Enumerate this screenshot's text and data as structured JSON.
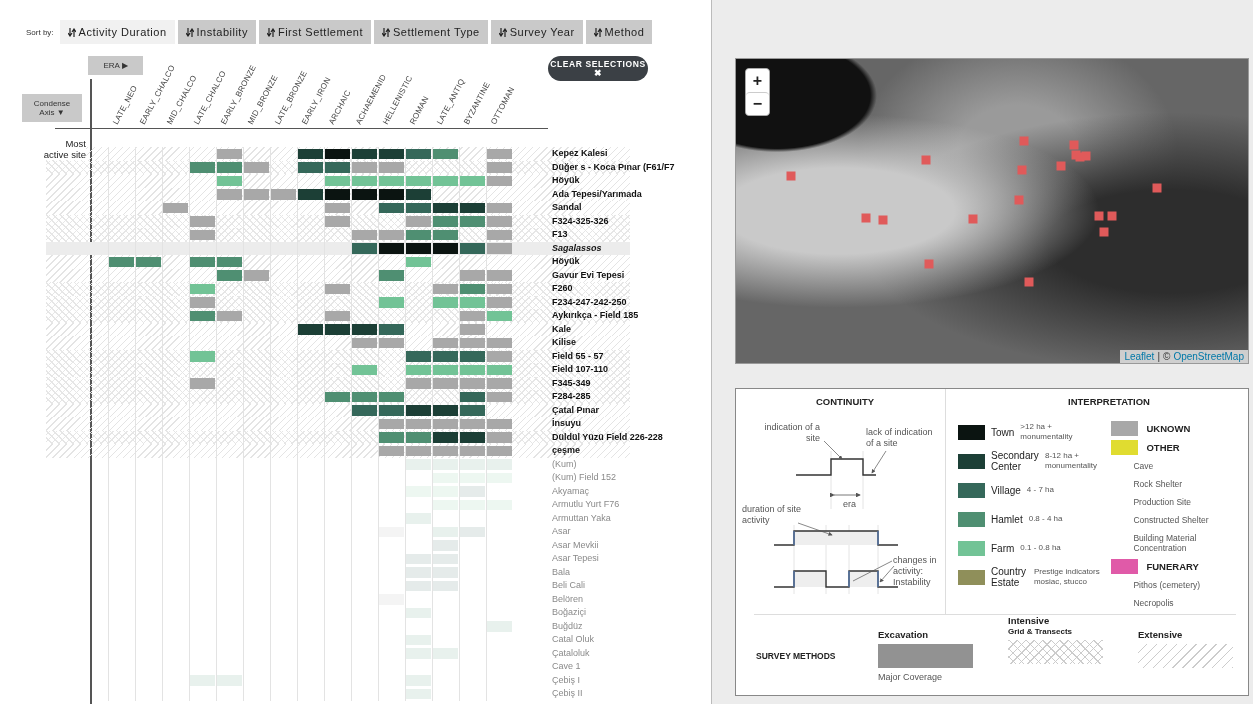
{
  "sort_bar": {
    "label": "Sort by:",
    "options": [
      {
        "label": "Activity Duration",
        "selected": true
      },
      {
        "label": "Instability",
        "selected": false
      },
      {
        "label": "First Settlement",
        "selected": false
      },
      {
        "label": "Settlement Type",
        "selected": false
      },
      {
        "label": "Survey Year",
        "selected": false
      },
      {
        "label": "Method",
        "selected": false
      }
    ]
  },
  "era_button": {
    "label": "ERA",
    "glyph": "▶"
  },
  "condense_button": {
    "label": "Condense Axis",
    "glyph": "▼"
  },
  "clear_button": {
    "label": "CLEAR SELECTIONS",
    "glyph": "✖"
  },
  "most_active_label": "Most active site",
  "eras": [
    "LATE_NEO",
    "EARLY_CHALCO",
    "MID_CHALCO",
    "LATE_CHALCO",
    "EARLY_BRONZE",
    "MID_BRONZE",
    "LATE_BRONZE",
    "EARLY_IRON",
    "ARCHAIC",
    "ACHAEMENID",
    "HELLENISTIC",
    "ROMAN",
    "LATE_ANTIQ",
    "BYZANTINE",
    "OTTOMAN"
  ],
  "sites": [
    {
      "name": "Kepez Kalesi",
      "kind": "extensive",
      "active": true,
      "cells": [
        {
          "kind": "none"
        },
        {
          "kind": "none"
        },
        {
          "kind": "none"
        },
        {
          "kind": "none"
        },
        {
          "kind": "unknown"
        },
        {
          "kind": "none"
        },
        {
          "kind": "none"
        },
        {
          "kind": "secondary"
        },
        {
          "kind": "town"
        },
        {
          "kind": "secondary"
        },
        {
          "kind": "secondary"
        },
        {
          "kind": "village"
        },
        {
          "kind": "hamlet"
        },
        {
          "kind": "none"
        },
        {
          "kind": "unknown"
        }
      ]
    },
    {
      "name": "Düğer s - Koca Pınar (F61/F7",
      "kind": "intensive",
      "active": true,
      "cells": [
        {
          "kind": "none"
        },
        {
          "kind": "none"
        },
        {
          "kind": "none"
        },
        {
          "kind": "hamlet"
        },
        {
          "kind": "hamlet"
        },
        {
          "kind": "unknown"
        },
        {
          "kind": "none"
        },
        {
          "kind": "village"
        },
        {
          "kind": "village"
        },
        {
          "kind": "unknown"
        },
        {
          "kind": "unknown"
        },
        {
          "kind": "none"
        },
        {
          "kind": "none"
        },
        {
          "kind": "none"
        },
        {
          "kind": "unknown"
        }
      ]
    },
    {
      "name": "Höyük",
      "kind": "extensive",
      "active": true,
      "cells": [
        {
          "kind": "none"
        },
        {
          "kind": "none"
        },
        {
          "kind": "none"
        },
        {
          "kind": "none"
        },
        {
          "kind": "farm"
        },
        {
          "kind": "none"
        },
        {
          "kind": "none"
        },
        {
          "kind": "none"
        },
        {
          "kind": "farm"
        },
        {
          "kind": "farm"
        },
        {
          "kind": "farm"
        },
        {
          "kind": "farm"
        },
        {
          "kind": "farm"
        },
        {
          "kind": "farm"
        },
        {
          "kind": "unknown"
        }
      ]
    },
    {
      "name": "Ada Tepesi/Yarımada",
      "kind": "extensive",
      "active": true,
      "cells": [
        {
          "kind": "none"
        },
        {
          "kind": "none"
        },
        {
          "kind": "none"
        },
        {
          "kind": "none"
        },
        {
          "kind": "unknown"
        },
        {
          "kind": "unknown"
        },
        {
          "kind": "unknown"
        },
        {
          "kind": "secondary"
        },
        {
          "kind": "town"
        },
        {
          "kind": "town"
        },
        {
          "kind": "town"
        },
        {
          "kind": "secondary"
        },
        {
          "kind": "none"
        },
        {
          "kind": "none"
        },
        {
          "kind": "none"
        }
      ]
    },
    {
      "name": "Sandal",
      "kind": "extensive",
      "active": true,
      "cells": [
        {
          "kind": "none"
        },
        {
          "kind": "none"
        },
        {
          "kind": "unknown"
        },
        {
          "kind": "none"
        },
        {
          "kind": "none"
        },
        {
          "kind": "none"
        },
        {
          "kind": "none"
        },
        {
          "kind": "none"
        },
        {
          "kind": "unknown"
        },
        {
          "kind": "none"
        },
        {
          "kind": "village"
        },
        {
          "kind": "village"
        },
        {
          "kind": "secondary"
        },
        {
          "kind": "secondary"
        },
        {
          "kind": "unknown"
        }
      ]
    },
    {
      "name": "F324-325-326",
      "kind": "intensive",
      "active": true,
      "cells": [
        {
          "kind": "none"
        },
        {
          "kind": "none"
        },
        {
          "kind": "none"
        },
        {
          "kind": "unknown"
        },
        {
          "kind": "none"
        },
        {
          "kind": "none"
        },
        {
          "kind": "none"
        },
        {
          "kind": "none"
        },
        {
          "kind": "unknown"
        },
        {
          "kind": "none"
        },
        {
          "kind": "none"
        },
        {
          "kind": "unknown"
        },
        {
          "kind": "hamlet"
        },
        {
          "kind": "hamlet"
        },
        {
          "kind": "unknown"
        }
      ]
    },
    {
      "name": "F13",
      "kind": "intensive",
      "active": true,
      "cells": [
        {
          "kind": "none"
        },
        {
          "kind": "none"
        },
        {
          "kind": "none"
        },
        {
          "kind": "unknown"
        },
        {
          "kind": "none"
        },
        {
          "kind": "none"
        },
        {
          "kind": "none"
        },
        {
          "kind": "none"
        },
        {
          "kind": "none"
        },
        {
          "kind": "unknown"
        },
        {
          "kind": "unknown"
        },
        {
          "kind": "hamlet"
        },
        {
          "kind": "hamlet"
        },
        {
          "kind": "none"
        },
        {
          "kind": "unknown"
        }
      ]
    },
    {
      "name": "Sagalassos",
      "kind": "excavation",
      "active": true,
      "cells": [
        {
          "kind": "none"
        },
        {
          "kind": "none"
        },
        {
          "kind": "none"
        },
        {
          "kind": "none"
        },
        {
          "kind": "none"
        },
        {
          "kind": "none"
        },
        {
          "kind": "none"
        },
        {
          "kind": "none"
        },
        {
          "kind": "none"
        },
        {
          "kind": "village"
        },
        {
          "kind": "town"
        },
        {
          "kind": "town"
        },
        {
          "kind": "town"
        },
        {
          "kind": "village"
        },
        {
          "kind": "unknown"
        }
      ]
    },
    {
      "name": "Höyük",
      "kind": "extensive",
      "active": true,
      "cells": [
        {
          "kind": "hamlet"
        },
        {
          "kind": "hamlet"
        },
        {
          "kind": "none"
        },
        {
          "kind": "hamlet"
        },
        {
          "kind": "hamlet"
        },
        {
          "kind": "none"
        },
        {
          "kind": "none"
        },
        {
          "kind": "none"
        },
        {
          "kind": "none"
        },
        {
          "kind": "none"
        },
        {
          "kind": "none"
        },
        {
          "kind": "farm"
        },
        {
          "kind": "none"
        },
        {
          "kind": "none"
        },
        {
          "kind": "none"
        }
      ]
    },
    {
      "name": "Gavur Evi Tepesi",
      "kind": "extensive",
      "active": true,
      "cells": [
        {
          "kind": "none"
        },
        {
          "kind": "none"
        },
        {
          "kind": "none"
        },
        {
          "kind": "none"
        },
        {
          "kind": "hamlet"
        },
        {
          "kind": "unknown"
        },
        {
          "kind": "none"
        },
        {
          "kind": "none"
        },
        {
          "kind": "none"
        },
        {
          "kind": "none"
        },
        {
          "kind": "hamlet"
        },
        {
          "kind": "none"
        },
        {
          "kind": "none"
        },
        {
          "kind": "unknown"
        },
        {
          "kind": "unknown"
        }
      ]
    },
    {
      "name": "F260",
      "kind": "intensive",
      "active": true,
      "cells": [
        {
          "kind": "none"
        },
        {
          "kind": "none"
        },
        {
          "kind": "none"
        },
        {
          "kind": "farm"
        },
        {
          "kind": "none"
        },
        {
          "kind": "none"
        },
        {
          "kind": "none"
        },
        {
          "kind": "none"
        },
        {
          "kind": "unknown"
        },
        {
          "kind": "none"
        },
        {
          "kind": "none"
        },
        {
          "kind": "none"
        },
        {
          "kind": "unknown"
        },
        {
          "kind": "hamlet"
        },
        {
          "kind": "unknown"
        }
      ]
    },
    {
      "name": "F234-247-242-250",
      "kind": "intensive",
      "active": true,
      "cells": [
        {
          "kind": "none"
        },
        {
          "kind": "none"
        },
        {
          "kind": "none"
        },
        {
          "kind": "unknown"
        },
        {
          "kind": "none"
        },
        {
          "kind": "none"
        },
        {
          "kind": "none"
        },
        {
          "kind": "none"
        },
        {
          "kind": "none"
        },
        {
          "kind": "none"
        },
        {
          "kind": "farm"
        },
        {
          "kind": "none"
        },
        {
          "kind": "farm"
        },
        {
          "kind": "farm"
        },
        {
          "kind": "unknown"
        }
      ]
    },
    {
      "name": "Aykırıkça - Field 185",
      "kind": "intensive",
      "active": true,
      "cells": [
        {
          "kind": "none"
        },
        {
          "kind": "none"
        },
        {
          "kind": "none"
        },
        {
          "kind": "hamlet"
        },
        {
          "kind": "unknown"
        },
        {
          "kind": "none"
        },
        {
          "kind": "none"
        },
        {
          "kind": "none"
        },
        {
          "kind": "unknown"
        },
        {
          "kind": "none"
        },
        {
          "kind": "none"
        },
        {
          "kind": "none"
        },
        {
          "kind": "none"
        },
        {
          "kind": "unknown"
        },
        {
          "kind": "farm"
        }
      ]
    },
    {
      "name": "Kale",
      "kind": "extensive",
      "active": true,
      "cells": [
        {
          "kind": "none"
        },
        {
          "kind": "none"
        },
        {
          "kind": "none"
        },
        {
          "kind": "none"
        },
        {
          "kind": "none"
        },
        {
          "kind": "none"
        },
        {
          "kind": "none"
        },
        {
          "kind": "secondary"
        },
        {
          "kind": "secondary"
        },
        {
          "kind": "secondary"
        },
        {
          "kind": "village"
        },
        {
          "kind": "none"
        },
        {
          "kind": "none"
        },
        {
          "kind": "unknown"
        },
        {
          "kind": "none"
        }
      ]
    },
    {
      "name": "Kilise",
      "kind": "extensive",
      "active": true,
      "cells": [
        {
          "kind": "none"
        },
        {
          "kind": "none"
        },
        {
          "kind": "none"
        },
        {
          "kind": "none"
        },
        {
          "kind": "none"
        },
        {
          "kind": "none"
        },
        {
          "kind": "none"
        },
        {
          "kind": "none"
        },
        {
          "kind": "none"
        },
        {
          "kind": "unknown"
        },
        {
          "kind": "unknown"
        },
        {
          "kind": "none"
        },
        {
          "kind": "unknown"
        },
        {
          "kind": "unknown"
        },
        {
          "kind": "unknown"
        }
      ]
    },
    {
      "name": "Field 55 - 57",
      "kind": "intensive",
      "active": true,
      "cells": [
        {
          "kind": "none"
        },
        {
          "kind": "none"
        },
        {
          "kind": "none"
        },
        {
          "kind": "farm"
        },
        {
          "kind": "none"
        },
        {
          "kind": "none"
        },
        {
          "kind": "none"
        },
        {
          "kind": "none"
        },
        {
          "kind": "none"
        },
        {
          "kind": "none"
        },
        {
          "kind": "none"
        },
        {
          "kind": "village"
        },
        {
          "kind": "village"
        },
        {
          "kind": "village"
        },
        {
          "kind": "unknown"
        }
      ]
    },
    {
      "name": "Field 107-110",
      "kind": "intensive",
      "active": true,
      "cells": [
        {
          "kind": "none"
        },
        {
          "kind": "none"
        },
        {
          "kind": "none"
        },
        {
          "kind": "none"
        },
        {
          "kind": "none"
        },
        {
          "kind": "none"
        },
        {
          "kind": "none"
        },
        {
          "kind": "none"
        },
        {
          "kind": "none"
        },
        {
          "kind": "farm"
        },
        {
          "kind": "none"
        },
        {
          "kind": "farm"
        },
        {
          "kind": "farm"
        },
        {
          "kind": "farm"
        },
        {
          "kind": "farm"
        }
      ]
    },
    {
      "name": "F345-349",
      "kind": "intensive",
      "active": true,
      "cells": [
        {
          "kind": "none"
        },
        {
          "kind": "none"
        },
        {
          "kind": "none"
        },
        {
          "kind": "unknown"
        },
        {
          "kind": "none"
        },
        {
          "kind": "none"
        },
        {
          "kind": "none"
        },
        {
          "kind": "none"
        },
        {
          "kind": "none"
        },
        {
          "kind": "none"
        },
        {
          "kind": "none"
        },
        {
          "kind": "unknown"
        },
        {
          "kind": "unknown"
        },
        {
          "kind": "unknown"
        },
        {
          "kind": "unknown"
        }
      ]
    },
    {
      "name": "F284-285",
      "kind": "intensive",
      "active": true,
      "cells": [
        {
          "kind": "none"
        },
        {
          "kind": "none"
        },
        {
          "kind": "none"
        },
        {
          "kind": "none"
        },
        {
          "kind": "none"
        },
        {
          "kind": "none"
        },
        {
          "kind": "none"
        },
        {
          "kind": "none"
        },
        {
          "kind": "hamlet"
        },
        {
          "kind": "hamlet"
        },
        {
          "kind": "hamlet"
        },
        {
          "kind": "none"
        },
        {
          "kind": "none"
        },
        {
          "kind": "village"
        },
        {
          "kind": "unknown"
        }
      ]
    },
    {
      "name": "Çatal Pınar",
      "kind": "extensive",
      "active": true,
      "cells": [
        {
          "kind": "none"
        },
        {
          "kind": "none"
        },
        {
          "kind": "none"
        },
        {
          "kind": "none"
        },
        {
          "kind": "none"
        },
        {
          "kind": "none"
        },
        {
          "kind": "none"
        },
        {
          "kind": "none"
        },
        {
          "kind": "none"
        },
        {
          "kind": "village"
        },
        {
          "kind": "village"
        },
        {
          "kind": "secondary"
        },
        {
          "kind": "secondary"
        },
        {
          "kind": "village"
        },
        {
          "kind": "none"
        }
      ]
    },
    {
      "name": "İnsuyu",
      "kind": "extensive",
      "active": true,
      "cells": [
        {
          "kind": "none"
        },
        {
          "kind": "none"
        },
        {
          "kind": "none"
        },
        {
          "kind": "none"
        },
        {
          "kind": "none"
        },
        {
          "kind": "none"
        },
        {
          "kind": "none"
        },
        {
          "kind": "none"
        },
        {
          "kind": "none"
        },
        {
          "kind": "none"
        },
        {
          "kind": "unknown"
        },
        {
          "kind": "unknown"
        },
        {
          "kind": "unknown"
        },
        {
          "kind": "unknown"
        },
        {
          "kind": "unknown"
        }
      ]
    },
    {
      "name": "Düldül Yüzü Field 226-228",
      "kind": "intensive",
      "active": true,
      "cells": [
        {
          "kind": "none"
        },
        {
          "kind": "none"
        },
        {
          "kind": "none"
        },
        {
          "kind": "none"
        },
        {
          "kind": "none"
        },
        {
          "kind": "none"
        },
        {
          "kind": "none"
        },
        {
          "kind": "none"
        },
        {
          "kind": "none"
        },
        {
          "kind": "none"
        },
        {
          "kind": "hamlet"
        },
        {
          "kind": "hamlet"
        },
        {
          "kind": "secondary"
        },
        {
          "kind": "secondary"
        },
        {
          "kind": "unknown"
        }
      ]
    },
    {
      "name": "çeşme",
      "kind": "extensive",
      "active": true,
      "cells": [
        {
          "kind": "none"
        },
        {
          "kind": "none"
        },
        {
          "kind": "none"
        },
        {
          "kind": "none"
        },
        {
          "kind": "none"
        },
        {
          "kind": "none"
        },
        {
          "kind": "none"
        },
        {
          "kind": "none"
        },
        {
          "kind": "none"
        },
        {
          "kind": "none"
        },
        {
          "kind": "unknown"
        },
        {
          "kind": "unknown"
        },
        {
          "kind": "unknown"
        },
        {
          "kind": "unknown"
        },
        {
          "kind": "unknown"
        }
      ]
    },
    {
      "name": "(Kum)",
      "active": false,
      "cells": [
        {
          "kind": "none"
        },
        {
          "kind": "none"
        },
        {
          "kind": "none"
        },
        {
          "kind": "none"
        },
        {
          "kind": "none"
        },
        {
          "kind": "none"
        },
        {
          "kind": "none"
        },
        {
          "kind": "none"
        },
        {
          "kind": "none"
        },
        {
          "kind": "none"
        },
        {
          "kind": "none"
        },
        {
          "kind": "hamlet"
        },
        {
          "kind": "hamlet"
        },
        {
          "kind": "hamlet"
        },
        {
          "kind": "hamlet"
        }
      ]
    },
    {
      "name": "(Kum) Field 152",
      "active": false,
      "cells": [
        {
          "kind": "none"
        },
        {
          "kind": "none"
        },
        {
          "kind": "none"
        },
        {
          "kind": "none"
        },
        {
          "kind": "none"
        },
        {
          "kind": "none"
        },
        {
          "kind": "none"
        },
        {
          "kind": "none"
        },
        {
          "kind": "none"
        },
        {
          "kind": "none"
        },
        {
          "kind": "none"
        },
        {
          "kind": "none"
        },
        {
          "kind": "farm"
        },
        {
          "kind": "farm"
        },
        {
          "kind": "farm"
        }
      ]
    },
    {
      "name": "Akyamaç",
      "active": false,
      "cells": [
        {
          "kind": "none"
        },
        {
          "kind": "none"
        },
        {
          "kind": "none"
        },
        {
          "kind": "none"
        },
        {
          "kind": "none"
        },
        {
          "kind": "none"
        },
        {
          "kind": "none"
        },
        {
          "kind": "none"
        },
        {
          "kind": "none"
        },
        {
          "kind": "none"
        },
        {
          "kind": "none"
        },
        {
          "kind": "farm"
        },
        {
          "kind": "farm"
        },
        {
          "kind": "village"
        },
        {
          "kind": "none"
        }
      ]
    },
    {
      "name": "Armutlu Yurt F76",
      "active": false,
      "cells": [
        {
          "kind": "none"
        },
        {
          "kind": "none"
        },
        {
          "kind": "none"
        },
        {
          "kind": "none"
        },
        {
          "kind": "none"
        },
        {
          "kind": "none"
        },
        {
          "kind": "none"
        },
        {
          "kind": "none"
        },
        {
          "kind": "none"
        },
        {
          "kind": "none"
        },
        {
          "kind": "none"
        },
        {
          "kind": "none"
        },
        {
          "kind": "farm"
        },
        {
          "kind": "farm"
        },
        {
          "kind": "farm"
        }
      ]
    },
    {
      "name": "Armuttan Yaka",
      "active": false,
      "cells": [
        {
          "kind": "none"
        },
        {
          "kind": "none"
        },
        {
          "kind": "none"
        },
        {
          "kind": "none"
        },
        {
          "kind": "none"
        },
        {
          "kind": "none"
        },
        {
          "kind": "none"
        },
        {
          "kind": "none"
        },
        {
          "kind": "none"
        },
        {
          "kind": "none"
        },
        {
          "kind": "none"
        },
        {
          "kind": "hamlet"
        },
        {
          "kind": "none"
        },
        {
          "kind": "none"
        },
        {
          "kind": "none"
        }
      ]
    },
    {
      "name": "Asar",
      "active": false,
      "cells": [
        {
          "kind": "none"
        },
        {
          "kind": "none"
        },
        {
          "kind": "none"
        },
        {
          "kind": "none"
        },
        {
          "kind": "none"
        },
        {
          "kind": "none"
        },
        {
          "kind": "none"
        },
        {
          "kind": "none"
        },
        {
          "kind": "none"
        },
        {
          "kind": "none"
        },
        {
          "kind": "unknown"
        },
        {
          "kind": "none"
        },
        {
          "kind": "hamlet"
        },
        {
          "kind": "village"
        },
        {
          "kind": "none"
        }
      ]
    },
    {
      "name": "Asar Mevkii",
      "active": false,
      "cells": [
        {
          "kind": "none"
        },
        {
          "kind": "none"
        },
        {
          "kind": "none"
        },
        {
          "kind": "none"
        },
        {
          "kind": "none"
        },
        {
          "kind": "none"
        },
        {
          "kind": "none"
        },
        {
          "kind": "none"
        },
        {
          "kind": "none"
        },
        {
          "kind": "none"
        },
        {
          "kind": "none"
        },
        {
          "kind": "none"
        },
        {
          "kind": "village"
        },
        {
          "kind": "none"
        },
        {
          "kind": "none"
        }
      ]
    },
    {
      "name": "Asar Tepesi",
      "active": false,
      "cells": [
        {
          "kind": "none"
        },
        {
          "kind": "none"
        },
        {
          "kind": "none"
        },
        {
          "kind": "none"
        },
        {
          "kind": "none"
        },
        {
          "kind": "none"
        },
        {
          "kind": "none"
        },
        {
          "kind": "none"
        },
        {
          "kind": "none"
        },
        {
          "kind": "none"
        },
        {
          "kind": "none"
        },
        {
          "kind": "village"
        },
        {
          "kind": "village"
        },
        {
          "kind": "none"
        },
        {
          "kind": "none"
        }
      ]
    },
    {
      "name": "Bala",
      "active": false,
      "cells": [
        {
          "kind": "none"
        },
        {
          "kind": "none"
        },
        {
          "kind": "none"
        },
        {
          "kind": "none"
        },
        {
          "kind": "none"
        },
        {
          "kind": "none"
        },
        {
          "kind": "none"
        },
        {
          "kind": "none"
        },
        {
          "kind": "none"
        },
        {
          "kind": "none"
        },
        {
          "kind": "none"
        },
        {
          "kind": "village"
        },
        {
          "kind": "village"
        },
        {
          "kind": "none"
        },
        {
          "kind": "none"
        }
      ]
    },
    {
      "name": "Beli Cali",
      "active": false,
      "cells": [
        {
          "kind": "none"
        },
        {
          "kind": "none"
        },
        {
          "kind": "none"
        },
        {
          "kind": "none"
        },
        {
          "kind": "none"
        },
        {
          "kind": "none"
        },
        {
          "kind": "none"
        },
        {
          "kind": "none"
        },
        {
          "kind": "none"
        },
        {
          "kind": "none"
        },
        {
          "kind": "none"
        },
        {
          "kind": "village"
        },
        {
          "kind": "village"
        },
        {
          "kind": "none"
        },
        {
          "kind": "none"
        }
      ]
    },
    {
      "name": "Belören",
      "active": false,
      "cells": [
        {
          "kind": "none"
        },
        {
          "kind": "none"
        },
        {
          "kind": "none"
        },
        {
          "kind": "none"
        },
        {
          "kind": "none"
        },
        {
          "kind": "none"
        },
        {
          "kind": "none"
        },
        {
          "kind": "none"
        },
        {
          "kind": "none"
        },
        {
          "kind": "none"
        },
        {
          "kind": "unknown"
        },
        {
          "kind": "none"
        },
        {
          "kind": "none"
        },
        {
          "kind": "none"
        },
        {
          "kind": "none"
        }
      ]
    },
    {
      "name": "Boğaziçi",
      "active": false,
      "cells": [
        {
          "kind": "none"
        },
        {
          "kind": "none"
        },
        {
          "kind": "none"
        },
        {
          "kind": "none"
        },
        {
          "kind": "none"
        },
        {
          "kind": "none"
        },
        {
          "kind": "none"
        },
        {
          "kind": "none"
        },
        {
          "kind": "none"
        },
        {
          "kind": "none"
        },
        {
          "kind": "none"
        },
        {
          "kind": "hamlet"
        },
        {
          "kind": "none"
        },
        {
          "kind": "none"
        },
        {
          "kind": "none"
        }
      ]
    },
    {
      "name": "Buğdüz",
      "active": false,
      "cells": [
        {
          "kind": "none"
        },
        {
          "kind": "none"
        },
        {
          "kind": "none"
        },
        {
          "kind": "none"
        },
        {
          "kind": "none"
        },
        {
          "kind": "none"
        },
        {
          "kind": "none"
        },
        {
          "kind": "none"
        },
        {
          "kind": "none"
        },
        {
          "kind": "none"
        },
        {
          "kind": "none"
        },
        {
          "kind": "none"
        },
        {
          "kind": "none"
        },
        {
          "kind": "none"
        },
        {
          "kind": "hamlet"
        }
      ]
    },
    {
      "name": "Catal Oluk",
      "active": false,
      "cells": [
        {
          "kind": "none"
        },
        {
          "kind": "none"
        },
        {
          "kind": "none"
        },
        {
          "kind": "none"
        },
        {
          "kind": "none"
        },
        {
          "kind": "none"
        },
        {
          "kind": "none"
        },
        {
          "kind": "none"
        },
        {
          "kind": "none"
        },
        {
          "kind": "none"
        },
        {
          "kind": "none"
        },
        {
          "kind": "hamlet"
        },
        {
          "kind": "none"
        },
        {
          "kind": "none"
        },
        {
          "kind": "none"
        }
      ]
    },
    {
      "name": "Çataloluk",
      "active": false,
      "cells": [
        {
          "kind": "none"
        },
        {
          "kind": "none"
        },
        {
          "kind": "none"
        },
        {
          "kind": "none"
        },
        {
          "kind": "none"
        },
        {
          "kind": "none"
        },
        {
          "kind": "none"
        },
        {
          "kind": "none"
        },
        {
          "kind": "none"
        },
        {
          "kind": "none"
        },
        {
          "kind": "none"
        },
        {
          "kind": "hamlet"
        },
        {
          "kind": "hamlet"
        },
        {
          "kind": "none"
        },
        {
          "kind": "none"
        }
      ]
    },
    {
      "name": "Cave 1",
      "active": false,
      "cells": [
        {
          "kind": "none"
        },
        {
          "kind": "none"
        },
        {
          "kind": "none"
        },
        {
          "kind": "none"
        },
        {
          "kind": "none"
        },
        {
          "kind": "none"
        },
        {
          "kind": "none"
        },
        {
          "kind": "none"
        },
        {
          "kind": "none"
        },
        {
          "kind": "none"
        },
        {
          "kind": "none"
        },
        {
          "kind": "none"
        },
        {
          "kind": "none"
        },
        {
          "kind": "none"
        },
        {
          "kind": "none"
        }
      ]
    },
    {
      "name": "Çebiş I",
      "active": false,
      "cells": [
        {
          "kind": "none"
        },
        {
          "kind": "none"
        },
        {
          "kind": "none"
        },
        {
          "kind": "hamlet"
        },
        {
          "kind": "hamlet"
        },
        {
          "kind": "none"
        },
        {
          "kind": "none"
        },
        {
          "kind": "none"
        },
        {
          "kind": "none"
        },
        {
          "kind": "none"
        },
        {
          "kind": "none"
        },
        {
          "kind": "hamlet"
        },
        {
          "kind": "none"
        },
        {
          "kind": "none"
        },
        {
          "kind": "none"
        }
      ]
    },
    {
      "name": "Çebiş II",
      "active": false,
      "cells": [
        {
          "kind": "none"
        },
        {
          "kind": "none"
        },
        {
          "kind": "none"
        },
        {
          "kind": "none"
        },
        {
          "kind": "none"
        },
        {
          "kind": "none"
        },
        {
          "kind": "none"
        },
        {
          "kind": "none"
        },
        {
          "kind": "none"
        },
        {
          "kind": "none"
        },
        {
          "kind": "none"
        },
        {
          "kind": "hamlet"
        },
        {
          "kind": "none"
        },
        {
          "kind": "none"
        },
        {
          "kind": "none"
        }
      ]
    }
  ],
  "map": {
    "zoom_in": "+",
    "zoom_out": "−",
    "attribution": [
      {
        "kind": "link",
        "text": "Leaflet"
      },
      {
        "kind": "text",
        "text": "|"
      },
      {
        "kind": "text",
        "text": "©"
      },
      {
        "kind": "link",
        "text": "OpenStreetMap"
      }
    ]
  },
  "legend": {
    "continuity": {
      "title": "CONTINUITY",
      "labels": [
        "indication of a site",
        "lack of indication of a site",
        "era",
        "duration of site activity",
        "changes in activity: Instability"
      ]
    },
    "interpretation": {
      "title": "INTERPRETATION",
      "sizes": [
        {
          "kind": "town",
          "name": "Town",
          "detail": ">12 ha + monumentality",
          "color": "#0b1411"
        },
        {
          "kind": "secondary",
          "name": "Secondary Center",
          "detail": "8-12 ha + monumentality",
          "color": "#1c3f36"
        },
        {
          "kind": "village",
          "name": "Village",
          "detail": "4 - 7 ha",
          "color": "#35685a"
        },
        {
          "kind": "hamlet",
          "name": "Hamlet",
          "detail": "0.8 - 4 ha",
          "color": "#4f8f72"
        },
        {
          "kind": "farm",
          "name": "Farm",
          "detail": "0.1 - 0.8 ha",
          "color": "#72c396"
        },
        {
          "kind": "country",
          "name": "Country Estate",
          "detail": "Prestige indicators mosiac, stucco",
          "color": "#8f8f5a"
        }
      ],
      "categories": [
        {
          "kind": "unknown",
          "name": "UKNOWN",
          "color": "#a8a8a8"
        },
        {
          "kind": "other",
          "name": "OTHER",
          "color": "#e0dc30",
          "examples": [
            "Cave",
            "Rock Shelter",
            "Production Site",
            "Constructed Shelter",
            "Building Material Concentration"
          ]
        },
        {
          "kind": "funerary",
          "name": "FUNERARY",
          "color": "#e05aa8",
          "examples": [
            "Pithos (cemetery)",
            "Necropolis"
          ]
        }
      ]
    },
    "survey_methods": {
      "title": "SURVEY METHODS",
      "methods": [
        {
          "kind": "excavation",
          "name": "Excavation",
          "note": "Major Coverage"
        },
        {
          "kind": "intensive",
          "name": "Intensive",
          "subtitle": "Grid & Transects"
        },
        {
          "kind": "extensive",
          "name": "Extensive"
        }
      ]
    }
  }
}
